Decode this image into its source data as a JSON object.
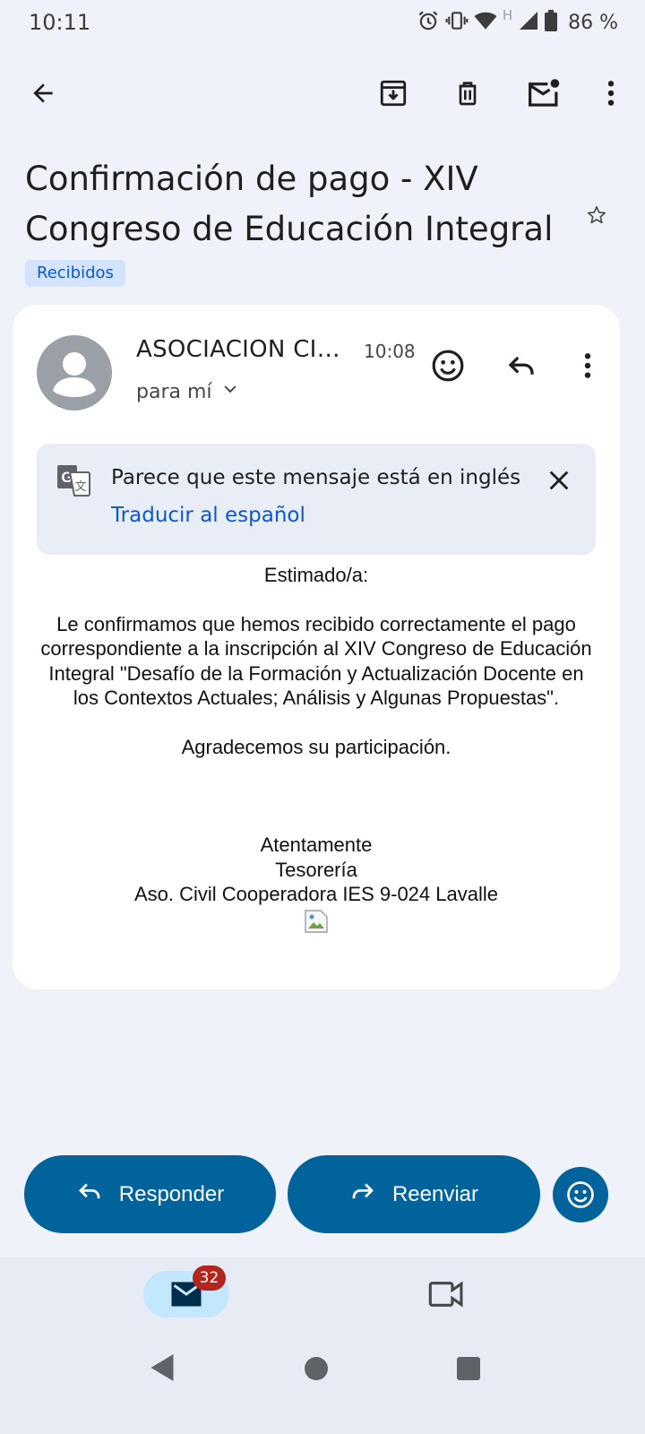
{
  "status_bar": {
    "time": "10:11",
    "battery_percent": "86 %",
    "network_label": "H",
    "icons": [
      "alarm-icon",
      "vibrate-icon",
      "wifi-icon",
      "signal-icon",
      "battery-icon"
    ]
  },
  "toolbar": {
    "icons": [
      "back-arrow-icon",
      "archive-icon",
      "delete-icon",
      "mark-unread-icon",
      "more-vert-icon"
    ]
  },
  "email": {
    "subject": "Confirmación de pago - XIV Congreso de Educación Integral",
    "label": "Recibidos",
    "sender": "ASOCIACION CIV…",
    "time": "10:08",
    "recipients": "para mí"
  },
  "translate_banner": {
    "message": "Parece que este mensaje está en inglés",
    "link": "Traducir al español"
  },
  "body": {
    "greeting": "Estimado/a:",
    "paragraph": "Le confirmamos que hemos recibido correctamente el pago correspondiente a la inscripción al XIV Congreso de Educación Integral \"Desafío de la Formación y Actualización Docente en los Contextos Actuales; Análisis y Algunas Propuestas\".",
    "thanks": "Agradecemos su participación.",
    "closing": "Atentamente",
    "signature_dept": "Tesorería",
    "signature_org": "Aso. Civil Cooperadora IES 9-024 Lavalle"
  },
  "actions": {
    "reply": "Responder",
    "forward": "Reenviar"
  },
  "bottom_nav": {
    "mail_badge": "32"
  },
  "colors": {
    "primary": "#00639b",
    "link": "#0b57d0",
    "badge": "#b3261e",
    "chip_bg": "#d3e3fd",
    "page_bg": "#f0f2f9"
  }
}
